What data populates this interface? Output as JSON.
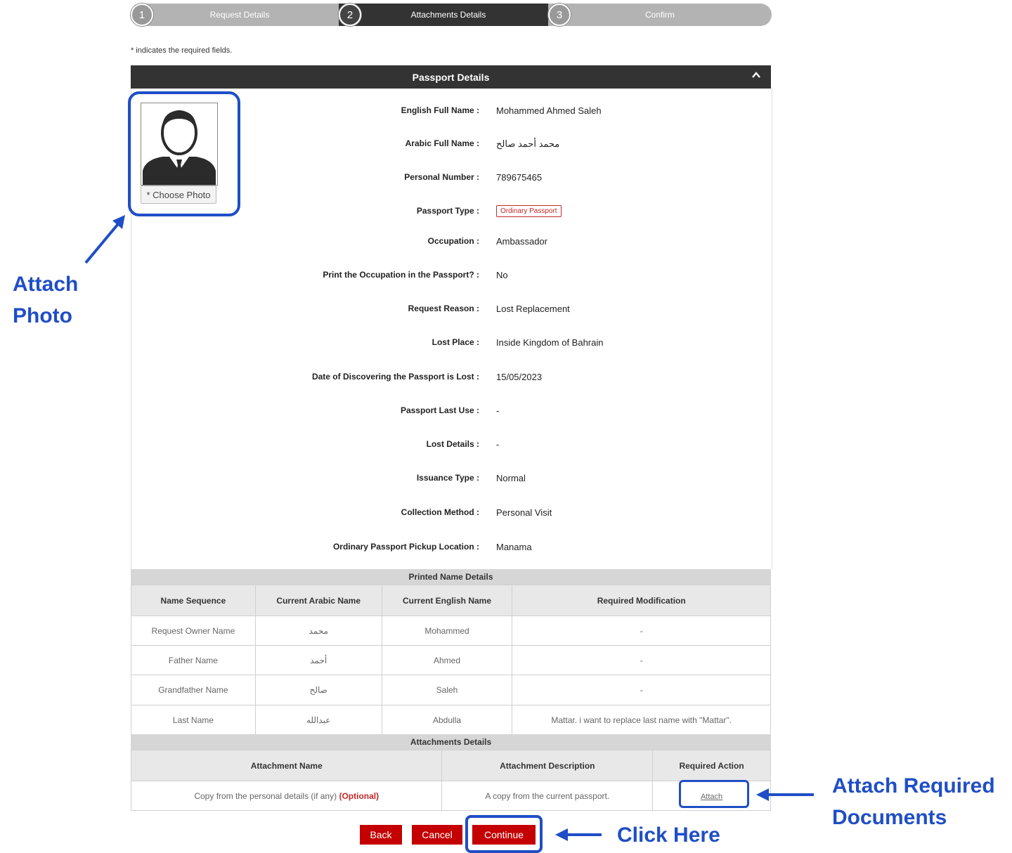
{
  "stepper": {
    "steps": [
      {
        "number": "1",
        "label": "Request Details"
      },
      {
        "number": "2",
        "label": "Attachments Details"
      },
      {
        "number": "3",
        "label": "Confirm"
      }
    ]
  },
  "required_note": "* indicates the required fields.",
  "panel": {
    "title": "Passport Details",
    "photo_button": "* Choose Photo",
    "fields": [
      {
        "label": "English Full Name :",
        "value": "Mohammed Ahmed Saleh"
      },
      {
        "label": "Arabic Full Name :",
        "value": "محمد أحمد صالح"
      },
      {
        "label": "Personal Number :",
        "value": "789675465"
      },
      {
        "label": "Passport Type :",
        "value": "Ordinary Passport"
      },
      {
        "label": "Occupation :",
        "value": "Ambassador"
      },
      {
        "label": "Print the Occupation in the Passport? :",
        "value": "No"
      },
      {
        "label": "Request Reason :",
        "value": "Lost Replacement"
      },
      {
        "label": "Lost Place :",
        "value": "Inside Kingdom of Bahrain"
      },
      {
        "label": "Date of Discovering the Passport is Lost :",
        "value": "15/05/2023"
      },
      {
        "label": "Passport Last Use :",
        "value": "-"
      },
      {
        "label": "Lost Details :",
        "value": "-"
      },
      {
        "label": "Issuance Type :",
        "value": "Normal"
      },
      {
        "label": "Collection Method :",
        "value": "Personal Visit"
      },
      {
        "label": "Ordinary Passport Pickup Location :",
        "value": "Manama"
      }
    ]
  },
  "printed_names": {
    "title": "Printed Name Details",
    "headers": [
      "Name Sequence",
      "Current Arabic Name",
      "Current English Name",
      "Required Modification"
    ],
    "rows": [
      [
        "Request Owner Name",
        "محمد",
        "Mohammed",
        "-"
      ],
      [
        "Father Name",
        "أحمد",
        "Ahmed",
        "-"
      ],
      [
        "Grandfather Name",
        "صالح",
        "Saleh",
        "-"
      ],
      [
        "Last Name",
        "عبدالله",
        "Abdulla",
        "Mattar. i want to replace last name with \"Mattar\"."
      ]
    ]
  },
  "attachments": {
    "title": "Attachments Details",
    "headers": [
      "Attachment Name",
      "Attachment Description",
      "Required Action"
    ],
    "row": {
      "name": "Copy from the personal details (if any)",
      "optional": "(Optional)",
      "description": "A copy from the current passport.",
      "action": "Attach"
    }
  },
  "buttons": {
    "back": "Back",
    "cancel": "Cancel",
    "continue": "Continue"
  },
  "annotations": {
    "photo": "Attach Photo",
    "documents": "Attach Required Documents",
    "continue": "Click Here"
  },
  "colors": {
    "accent": "#c40000",
    "annotation": "#1f4ec6",
    "header": "#333333"
  }
}
